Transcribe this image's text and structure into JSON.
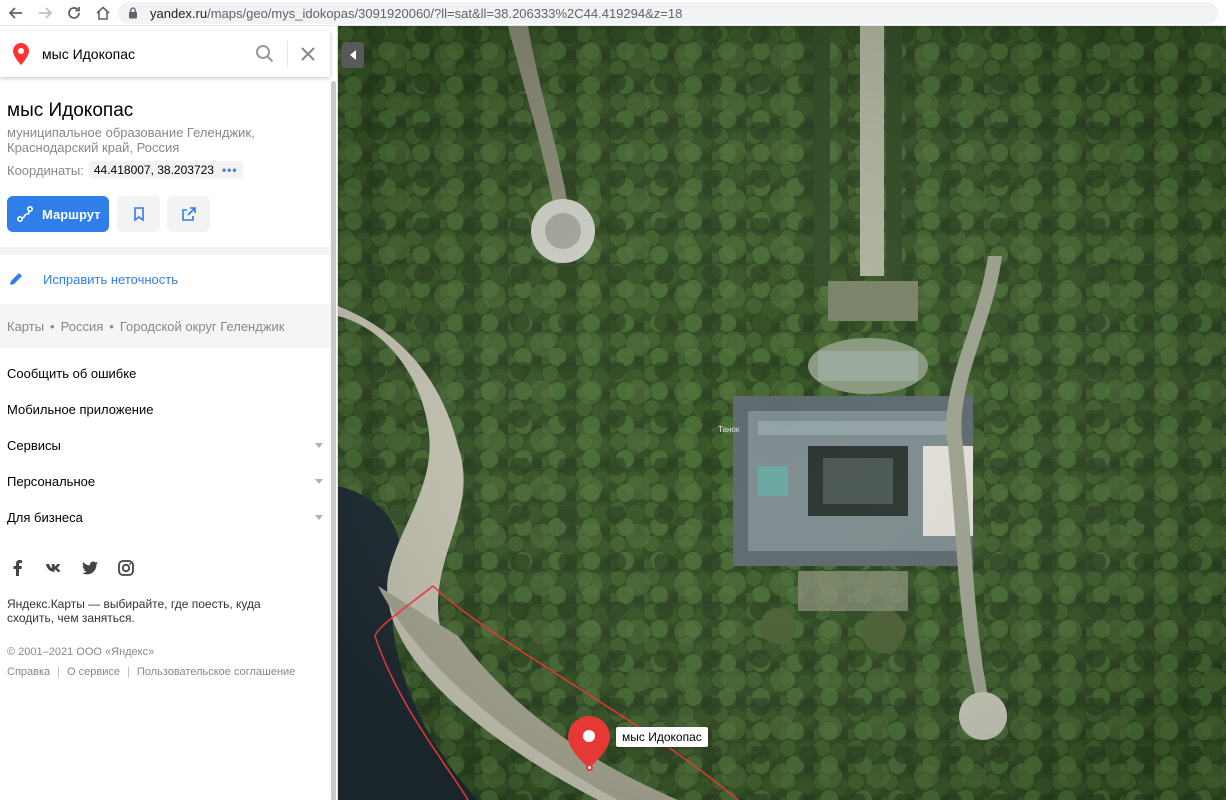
{
  "browser": {
    "url_host": "yandex.ru",
    "url_path": "/maps/geo/mys_idokopas/3091920060/?ll=sat&ll=38.206333%2C44.419294&z=18"
  },
  "search": {
    "value": "мыс Идокопас"
  },
  "place": {
    "title": "мыс Идокопас",
    "subtitle": "муниципальное образование Геленджик, Краснодарский край, Россия",
    "coords_label": "Координаты:",
    "coords_value": "44.418007, 38.203723",
    "coords_more": "•••"
  },
  "actions": {
    "route_label": "Маршрут"
  },
  "fix": {
    "label": "Исправить неточность"
  },
  "breadcrumbs": [
    "Карты",
    "Россия",
    "Городской округ Геленджик"
  ],
  "menu": [
    {
      "label": "Сообщить об ошибке",
      "has_arrow": false
    },
    {
      "label": "Мобильное приложение",
      "has_arrow": false
    },
    {
      "label": "Сервисы",
      "has_arrow": true
    },
    {
      "label": "Персональное",
      "has_arrow": true
    },
    {
      "label": "Для бизнеса",
      "has_arrow": true
    }
  ],
  "social": [
    "facebook-icon",
    "vk-icon",
    "twitter-icon",
    "instagram-icon"
  ],
  "footer": {
    "tagline": "Яндекс.Карты — выбирайте, где поесть, куда сходить, чем заняться.",
    "copyright": "© 2001–2021 ООО «Яндекс»",
    "links": [
      "Справка",
      "О сервисе",
      "Пользовательское соглашение"
    ]
  },
  "map": {
    "marker_label": "мыс Идокопас",
    "building_label": "Танок",
    "marker_color": "#e53935",
    "boundary_color": "#e53935"
  },
  "colors": {
    "accent": "#2f7ee9"
  }
}
